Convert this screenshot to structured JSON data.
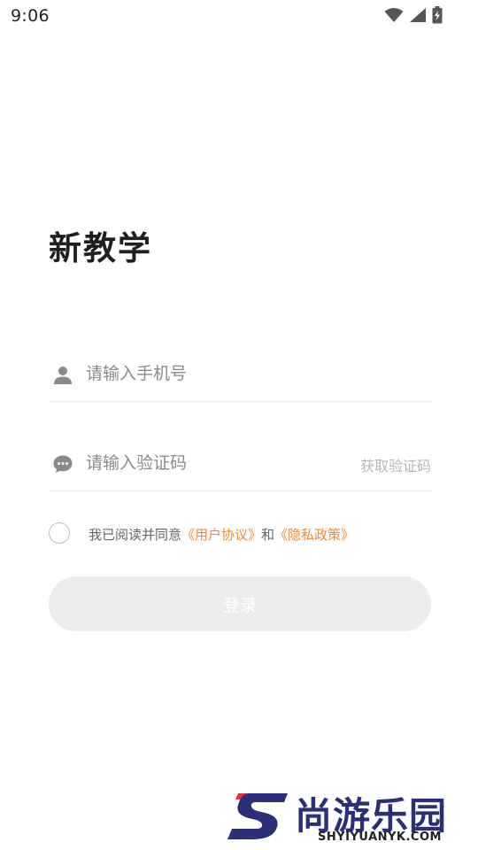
{
  "status_bar": {
    "time": "9:06",
    "icons": [
      "wifi-icon",
      "cell-signal-icon",
      "battery-charging-icon"
    ]
  },
  "app": {
    "title": "新教学"
  },
  "form": {
    "phone": {
      "icon": "user-icon",
      "value": "",
      "placeholder": "请输入手机号"
    },
    "code": {
      "icon": "chat-bubble-icon",
      "value": "",
      "placeholder": "请输入验证码",
      "get_code_label": "获取验证码"
    }
  },
  "agreement": {
    "checked": false,
    "prefix": "我已阅读并同意",
    "user_agreement": "《用户协议》",
    "conjunction": "和",
    "privacy_policy": "《隐私政策》"
  },
  "login": {
    "label": "登录"
  },
  "watermark": {
    "brand": "尚游乐园",
    "url": "SHYIYUANYK.COM"
  },
  "colors": {
    "link": "#ef8a2e",
    "button_disabled_bg": "#ececec",
    "icon_gray": "#8a8a8a",
    "placeholder": "#8a8a8a",
    "brand_navy": "#2b2f7a",
    "brand_red": "#e0303a"
  }
}
